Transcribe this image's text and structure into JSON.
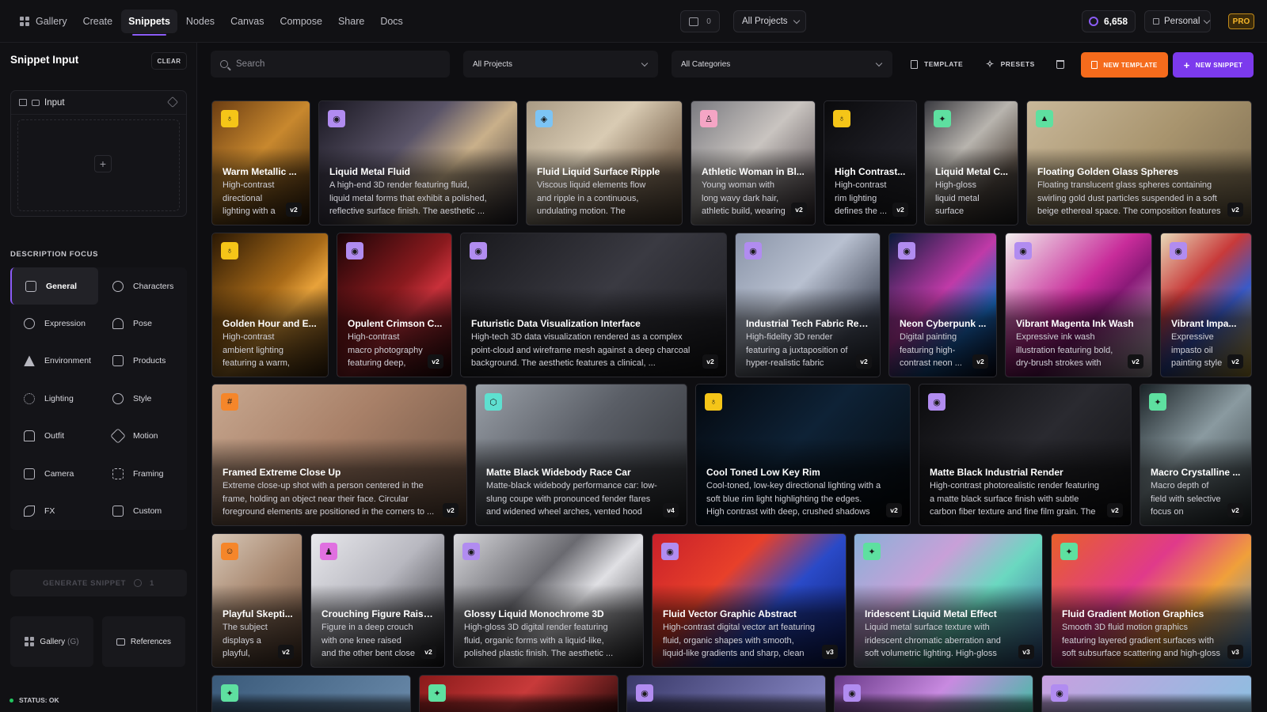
{
  "nav": {
    "gallery": "Gallery",
    "create": "Create",
    "snippets": "Snippets",
    "nodes": "Nodes",
    "canvas": "Canvas",
    "compose": "Compose",
    "share": "Share",
    "docs": "Docs"
  },
  "header": {
    "cart_count": "0",
    "project_select": "All Projects",
    "credits": "6,658",
    "workspace": "Personal",
    "plan_badge": "PRO"
  },
  "sidebar": {
    "title": "Snippet Input",
    "clear": "CLEAR",
    "input_label": "Input",
    "add_symbol": "+",
    "focus_label": "DESCRIPTION FOCUS",
    "focus_items": [
      "General",
      "Characters",
      "Expression",
      "Pose",
      "Environment",
      "Products",
      "Lighting",
      "Style",
      "Outfit",
      "Motion",
      "Camera",
      "Framing",
      "FX",
      "Custom"
    ],
    "generate": "GENERATE SNIPPET",
    "generate_cost": "1",
    "gallery_btn": "Gallery",
    "gallery_shortcut": "(G)",
    "references_btn": "References",
    "status": "STATUS: OK"
  },
  "toolbar": {
    "search_placeholder": "Search",
    "projects_filter": "All Projects",
    "categories_filter": "All Categories",
    "template": "TEMPLATE",
    "presets": "PRESETS",
    "new_template": "NEW TEMPLATE",
    "new_snippet": "NEW SNIPPET"
  },
  "cards": [
    {
      "title": "Warm Metallic ...",
      "desc": "High-contrast directional lighting with a warm ...",
      "ver": "v2",
      "badge": "bulb-icon",
      "badge_color": "#f5c518",
      "bg": "linear-gradient(135deg,#6b3d12,#c8882e 45%,#3a230c)"
    },
    {
      "title": "Liquid Metal Fluid",
      "desc": "A high-end 3D render featuring fluid, liquid metal forms that exhibit a polished, reflective surface finish. The aesthetic ...",
      "ver": "",
      "badge": "palette-icon",
      "badge_color": "#b18cf0",
      "bg": "linear-gradient(135deg,#1a1822,#5a5468 40%,#c9b08a 62%,#2a2630)"
    },
    {
      "title": "Fluid Liquid Surface Ripple",
      "desc": "Viscous liquid elements flow and ripple in a continuous, undulating motion. The surfaces shift and ...",
      "ver": "",
      "badge": "tag-icon",
      "badge_color": "#7cc4f5",
      "bg": "linear-gradient(135deg,#a89a84,#d9cbb3 40%,#8a7660 70%,#5e4e3e)"
    },
    {
      "title": "Athletic Woman in Bl...",
      "desc": "Young woman with long wavy dark hair, athletic build, wearing a ...",
      "ver": "v2",
      "badge": "person-icon",
      "badge_color": "#f5a5c5",
      "bg": "linear-gradient(135deg,#7a7a80,#c9c4c0 45%,#3a3036)"
    },
    {
      "title": "High Contrast...",
      "desc": "High-contrast rim lighting defines the ...",
      "ver": "v2",
      "badge": "bulb-icon",
      "badge_color": "#f5c518",
      "bg": "linear-gradient(135deg,#0a0a0c,#1c1c22 50%,#2a2a30)"
    },
    {
      "title": "Liquid Metal C...",
      "desc": "High-gloss liquid metal surface simulation with ...",
      "ver": "",
      "badge": "sparkle-icon",
      "badge_color": "#5ee0a0",
      "bg": "linear-gradient(135deg,#3a3a40,#b8b4ae 40%,#5a5048 70%,#2a2a2e)"
    },
    {
      "title": "Floating Golden Glass Spheres",
      "desc": "Floating translucent glass spheres containing swirling gold dust particles suspended in a soft beige ethereal space. The composition features ...",
      "ver": "v2",
      "badge": "mountain-icon",
      "badge_color": "#5ee0a0",
      "bg": "linear-gradient(135deg,#c9b89a,#a8946e 50%,#7a6a4e)"
    },
    {
      "title": "Golden Hour and E...",
      "desc": "High-contrast ambient lighting featuring a warm, golden-hour ...",
      "ver": "",
      "badge": "bulb-icon",
      "badge_color": "#f5c518",
      "bg": "linear-gradient(135deg,#2a1804,#a86a18 45%,#e8a23a 60%,#4a2e0e)"
    },
    {
      "title": "Opulent Crimson C...",
      "desc": "High-contrast macro photography featuring deep, saturated ...",
      "ver": "v2",
      "badge": "palette-icon",
      "badge_color": "#b18cf0",
      "bg": "linear-gradient(135deg,#1a0406,#8a1a1e 45%,#c8303a 60%,#2a080a)"
    },
    {
      "title": "Futuristic Data Visualization Interface",
      "desc": "High-tech 3D data visualization rendered as a complex point-cloud and wireframe mesh against a deep charcoal background. The aesthetic features a clinical, ...",
      "ver": "v2",
      "badge": "palette-icon",
      "badge_color": "#b18cf0",
      "bg": "linear-gradient(135deg,#18181c,#3a3a42 50%,#1a1a1e)"
    },
    {
      "title": "Industrial Tech Fabric Ren...",
      "desc": "High-fidelity 3D render featuring a juxtaposition of hyper-realistic fabric texture ...",
      "ver": "v2",
      "badge": "palette-icon",
      "badge_color": "#b18cf0",
      "bg": "linear-gradient(135deg,#8a94a8,#b8c0d0 40%,#4a5060 75%,#2a2e38)"
    },
    {
      "title": "Neon Cyberpunk ...",
      "desc": "Digital painting featuring high-contrast neon ...",
      "ver": "v2",
      "badge": "palette-icon",
      "badge_color": "#b18cf0",
      "bg": "linear-gradient(135deg,#0a1a3a,#c03aa8 45%,#1a6ac0 70%,#0a0a1e)"
    },
    {
      "title": "Vibrant Magenta Ink Wash",
      "desc": "Expressive ink wash illustration featuring bold, dry-brush strokes with visible ...",
      "ver": "v2",
      "badge": "palette-icon",
      "badge_color": "#b18cf0",
      "bg": "linear-gradient(135deg,#f2eeee,#c82c9a 45%,#8a1a78 60%,#e8e4e6)"
    },
    {
      "title": "Vibrant Impa...",
      "desc": "Expressive impasto oil painting style ...",
      "ver": "v2",
      "badge": "palette-icon",
      "badge_color": "#b18cf0",
      "bg": "linear-gradient(135deg,#e8d8b8,#c83a3a 35%,#3a5ac8 60%,#e8c03a)"
    },
    {
      "title": "Framed Extreme Close Up",
      "desc": "Extreme close-up shot with a person centered in the frame, holding an object near their face. Circular foreground elements are positioned in the corners to ...",
      "ver": "v2",
      "badge": "frame-icon",
      "badge_color": "#f5862a",
      "bg": "linear-gradient(135deg,#c8a890,#a88068 45%,#6a5040)"
    },
    {
      "title": "Matte Black Widebody Race Car",
      "desc": "Matte-black widebody performance car: low-slung coupe with pronounced fender flares and widened wheel arches, vented hood with ...",
      "ver": "v4",
      "badge": "box-icon",
      "badge_color": "#5ee0d0",
      "bg": "linear-gradient(135deg,#9aa0a8,#5a5e66 45%,#2a2c30)"
    },
    {
      "title": "Cool Toned Low Key Rim",
      "desc": "Cool-toned, low-key directional lighting with a soft blue rim light highlighting the edges. High contrast with deep, crushed shadows and ...",
      "ver": "v2",
      "badge": "bulb-icon",
      "badge_color": "#f5c518",
      "bg": "linear-gradient(135deg,#04080e,#0e2236 45%,#05070a)"
    },
    {
      "title": "Matte Black Industrial Render",
      "desc": "High-contrast photorealistic render featuring a matte black surface finish with subtle carbon fiber texture and fine film grain. The lighting ...",
      "ver": "v2",
      "badge": "palette-icon",
      "badge_color": "#b18cf0",
      "bg": "linear-gradient(135deg,#0a0a0c,#2a2a30 50%,#101012)"
    },
    {
      "title": "Macro Crystalline ...",
      "desc": "Macro depth of field with selective focus on crystalline surface ...",
      "ver": "v2",
      "badge": "sparkle-icon",
      "badge_color": "#5ee0a0",
      "bg": "linear-gradient(135deg,#1a2226,#8a9aa0 45%,#2a3236)"
    },
    {
      "title": "Playful Skepti...",
      "desc": "The subject displays a playful, skeptical ...",
      "ver": "v2",
      "badge": "face-icon",
      "badge_color": "#f5862a",
      "bg": "linear-gradient(135deg,#d8c8b8,#a88870 45%,#5a4030)"
    },
    {
      "title": "Crouching Figure Raise...",
      "desc": "Figure in a deep crouch with one knee raised and the other bent close to ...",
      "ver": "v2",
      "badge": "figure-icon",
      "badge_color": "#e070e0",
      "bg": "linear-gradient(135deg,#e8e8ec,#b8b8c0 45%,#1a1a1e)"
    },
    {
      "title": "Glossy Liquid Monochrome 3D",
      "desc": "High-gloss 3D digital render featuring fluid, organic forms with a liquid-like, polished plastic finish. The aesthetic ...",
      "ver": "",
      "badge": "palette-icon",
      "badge_color": "#b18cf0",
      "bg": "linear-gradient(135deg,#d8d8dc,#6a6a70 40%,#e0e0e4 60%,#2a2a2e)"
    },
    {
      "title": "Fluid Vector Graphic Abstract",
      "desc": "High-contrast digital vector art featuring fluid, organic shapes with smooth, liquid-like gradients and sharp, clean edges.",
      "ver": "v3",
      "badge": "palette-icon",
      "badge_color": "#b18cf0",
      "bg": "linear-gradient(135deg,#c8202a,#e8402a 35%,#2a4ac8 60%,#0a1a6a)"
    },
    {
      "title": "Iridescent Liquid Metal Effect",
      "desc": "Liquid metal surface texture with iridescent chromatic aberration and soft volumetric lighting. High-gloss finish with ...",
      "ver": "v3",
      "badge": "sparkle-icon",
      "badge_color": "#5ee0a0",
      "bg": "linear-gradient(135deg,#8ab0d8,#c8a0d8 35%,#6ad8c0 60%,#3a5a9a)"
    },
    {
      "title": "Fluid Gradient Motion Graphics",
      "desc": "Smooth 3D fluid motion graphics featuring layered gradient surfaces with soft subsurface scattering and high-gloss ...",
      "ver": "v3",
      "badge": "sparkle-icon",
      "badge_color": "#5ee0a0",
      "bg": "linear-gradient(135deg,#e8602a,#e03a8a 40%,#f0a03a 65%,#3a8ae0)"
    },
    {
      "title": "",
      "desc": "",
      "ver": "",
      "badge": "sparkle-icon",
      "badge_color": "#5ee0a0",
      "bg": "linear-gradient(135deg,#3a5a7a,#6a8aaa)"
    },
    {
      "title": "",
      "desc": "",
      "ver": "",
      "badge": "sparkle-icon",
      "badge_color": "#5ee0a0",
      "bg": "linear-gradient(135deg,#8a1a1a,#c83a3a 50%,#2a0a0a)"
    },
    {
      "title": "",
      "desc": "",
      "ver": "",
      "badge": "palette-icon",
      "badge_color": "#b18cf0",
      "bg": "linear-gradient(135deg,#3a3a6a,#8a8ac8)"
    },
    {
      "title": "",
      "desc": "",
      "ver": "",
      "badge": "palette-icon",
      "badge_color": "#b18cf0",
      "bg": "linear-gradient(135deg,#6a3a8a,#c88ae0 50%,#3ac0a0)"
    },
    {
      "title": "",
      "desc": "",
      "ver": "",
      "badge": "palette-icon",
      "badge_color": "#b18cf0",
      "bg": "linear-gradient(135deg,#c8a0e0,#8ac0e0)"
    }
  ]
}
